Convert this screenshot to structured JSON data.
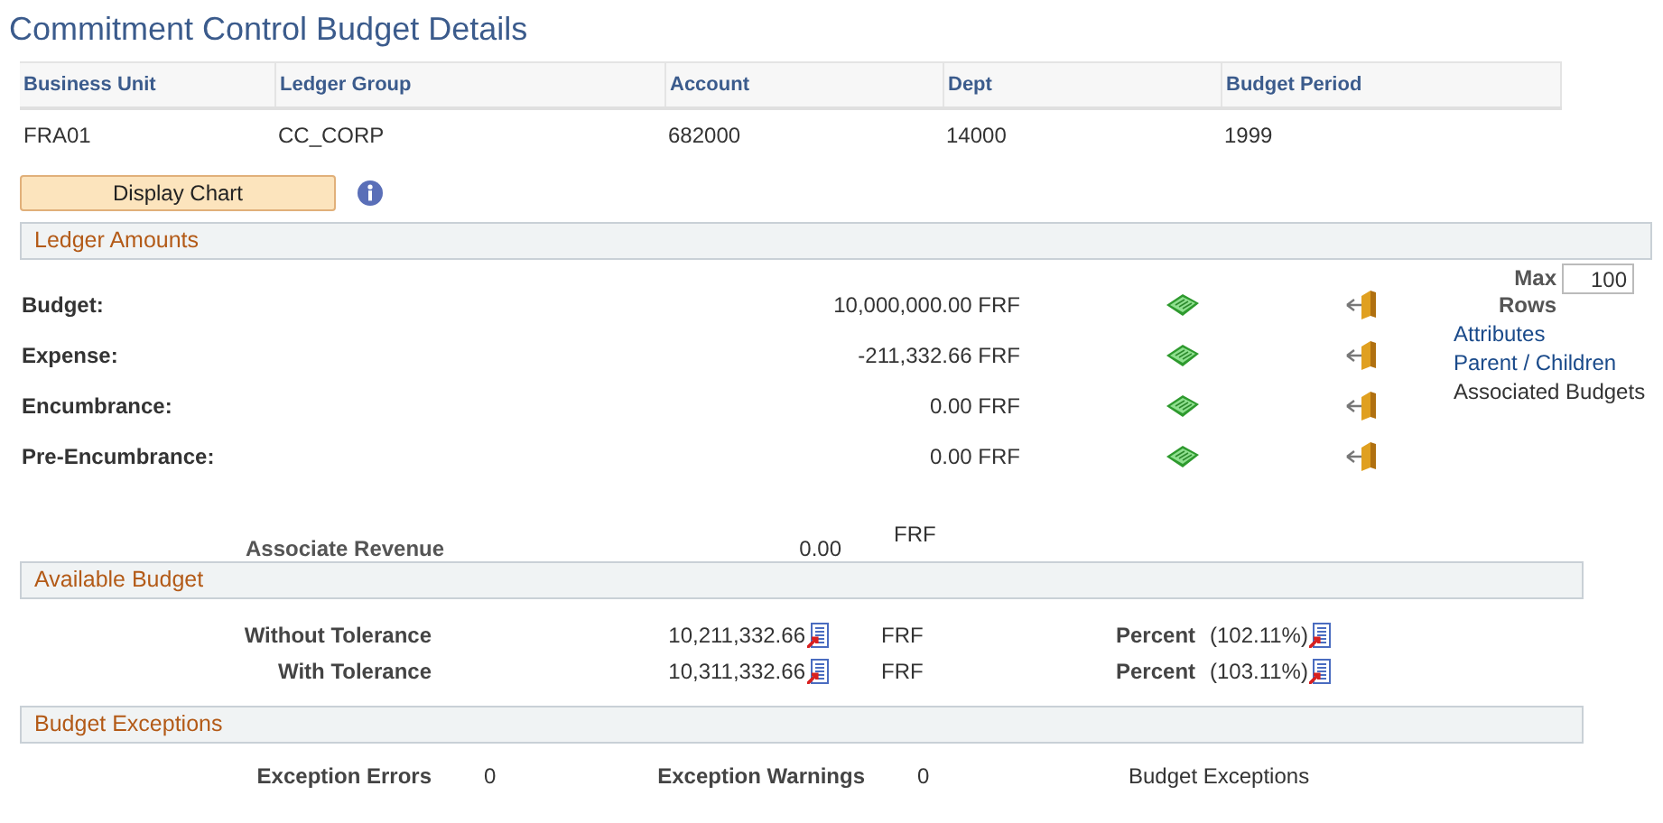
{
  "page_title": "Commitment Control Budget Details",
  "header_table": {
    "columns": [
      "Business Unit",
      "Ledger Group",
      "Account",
      "Dept",
      "Budget Period"
    ],
    "rows": [
      [
        "FRA01",
        "CC_CORP",
        "682000",
        "14000",
        "1999"
      ]
    ]
  },
  "display_chart_button": "Display Chart",
  "ledger_amounts": {
    "title": "Ledger Amounts",
    "rows": [
      {
        "label": "Budget:",
        "amount": "10,000,000.00 FRF"
      },
      {
        "label": "Expense:",
        "amount": "-211,332.66 FRF"
      },
      {
        "label": "Encumbrance:",
        "amount": "0.00 FRF"
      },
      {
        "label": "Pre-Encumbrance:",
        "amount": "0.00 FRF"
      }
    ],
    "max_rows": {
      "label": "Max Rows",
      "value": "100"
    },
    "links": [
      {
        "text": "Attributes",
        "kind": "link"
      },
      {
        "text": "Parent / Children",
        "kind": "link"
      },
      {
        "text": "Associated Budgets",
        "kind": "text"
      }
    ]
  },
  "associate_revenue": {
    "label": "Associate Revenue",
    "value": "0.00",
    "currency": "FRF"
  },
  "available_budget": {
    "title": "Available Budget",
    "rows": [
      {
        "label": "Without Tolerance",
        "amount": "10,211,332.66",
        "currency": "FRF",
        "percent_label": "Percent",
        "percent": "(102.11%)"
      },
      {
        "label": "With Tolerance",
        "amount": "10,311,332.66",
        "currency": "FRF",
        "percent_label": "Percent",
        "percent": "(103.11%)"
      }
    ]
  },
  "budget_exceptions": {
    "title": "Budget Exceptions",
    "items": [
      {
        "label": "Exception Errors",
        "value": "0"
      },
      {
        "label": "Exception Warnings",
        "value": "0"
      }
    ],
    "text": "Budget Exceptions"
  }
}
